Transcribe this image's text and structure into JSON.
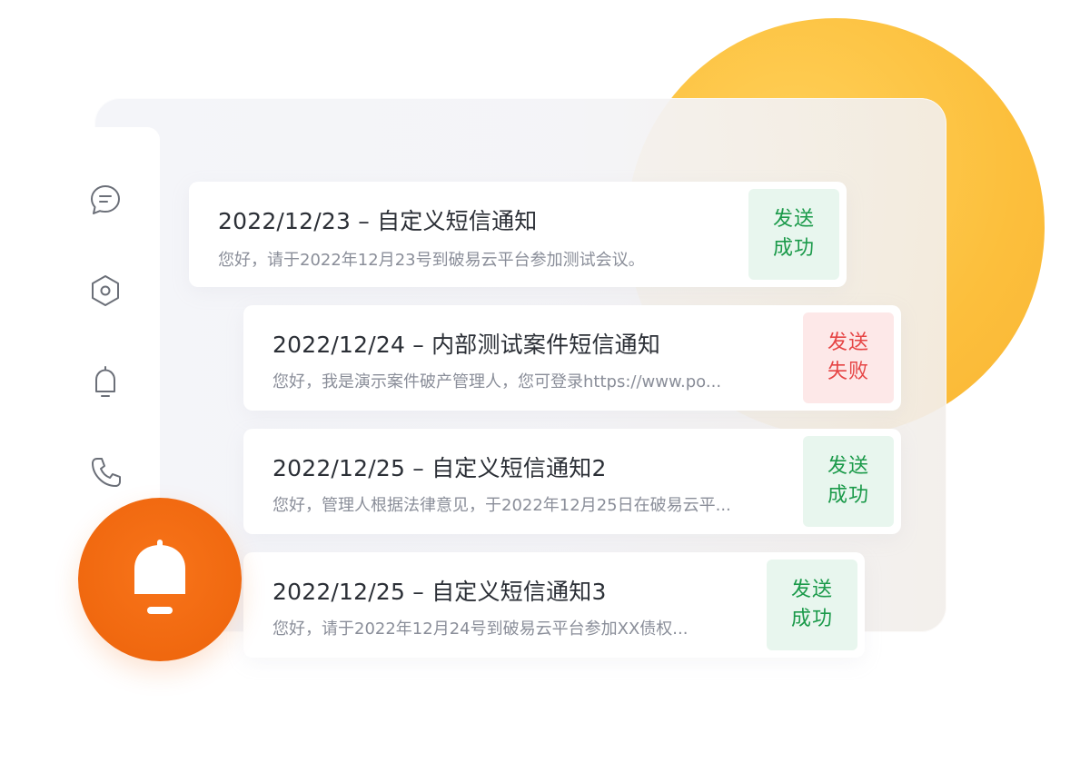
{
  "colors": {
    "accent": "#f0680f",
    "deco_circle": "#fcbf3c",
    "success_text": "#1b9a4a",
    "success_bg": "#e8f6ee",
    "fail_text": "#e64545",
    "fail_bg": "#fde8e8"
  },
  "sidebar": {
    "icons": [
      "message-icon",
      "settings-hexagon-icon",
      "bell-icon",
      "phone-icon"
    ]
  },
  "fab": {
    "icon": "bell-icon"
  },
  "messages": [
    {
      "title": "2022/12/23 – 自定义短信通知",
      "body": "您好，请于2022年12月23号到破易云平台参加测试会议。",
      "status_line1": "发送",
      "status_line2": "成功",
      "status": "success"
    },
    {
      "title": "2022/12/24 – 内部测试案件短信通知",
      "body": "您好，我是演示案件破产管理人，您可登录https://www.po...",
      "status_line1": "发送",
      "status_line2": "失败",
      "status": "fail"
    },
    {
      "title": "2022/12/25 – 自定义短信通知2",
      "body": "您好，管理人根据法律意见，于2022年12月25日在破易云平...",
      "status_line1": "发送",
      "status_line2": "成功",
      "status": "success"
    },
    {
      "title": "2022/12/25 – 自定义短信通知3",
      "body": "您好，请于2022年12月24号到破易云平台参加XX债权...",
      "status_line1": "发送",
      "status_line2": "成功",
      "status": "success"
    }
  ]
}
